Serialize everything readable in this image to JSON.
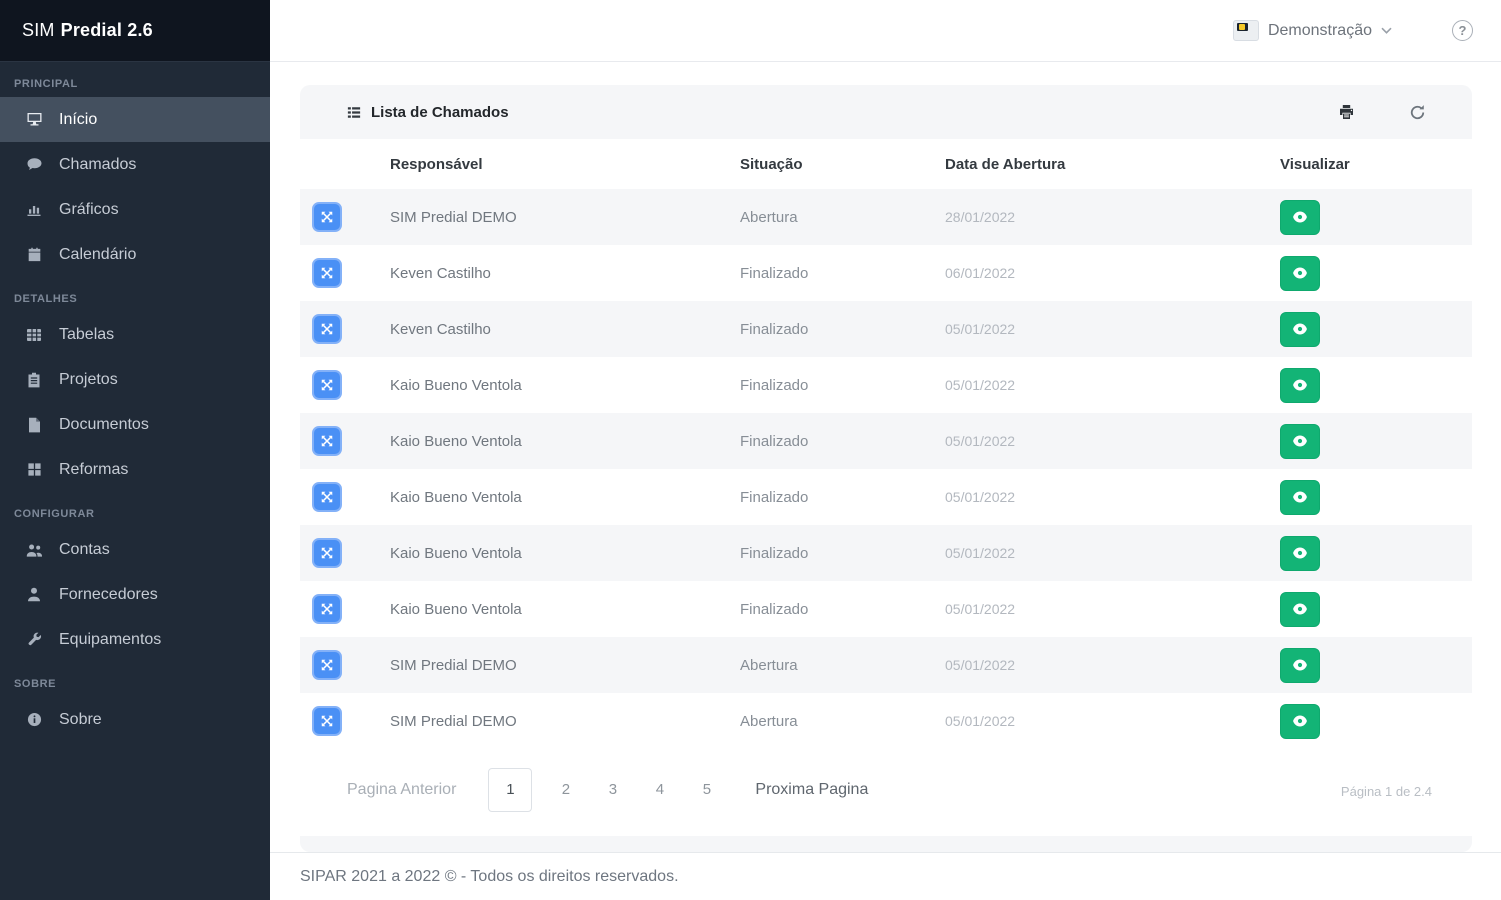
{
  "brand": {
    "name_light": "SIM",
    "name_bold": "Predial 2.6"
  },
  "sidebar": {
    "sections": [
      {
        "label": "PRINCIPAL",
        "items": [
          {
            "label": "Início",
            "icon": "desktop-icon",
            "active": true
          },
          {
            "label": "Chamados",
            "icon": "comment-icon",
            "active": false
          },
          {
            "label": "Gráficos",
            "icon": "chart-icon",
            "active": false
          },
          {
            "label": "Calendário",
            "icon": "calendar-icon",
            "active": false
          }
        ]
      },
      {
        "label": "DETALHES",
        "items": [
          {
            "label": "Tabelas",
            "icon": "table-icon",
            "active": false
          },
          {
            "label": "Projetos",
            "icon": "clipboard-icon",
            "active": false
          },
          {
            "label": "Documentos",
            "icon": "document-icon",
            "active": false
          },
          {
            "label": "Reformas",
            "icon": "grid-icon",
            "active": false
          }
        ]
      },
      {
        "label": "CONFIGURAR",
        "items": [
          {
            "label": "Contas",
            "icon": "users-icon",
            "active": false
          },
          {
            "label": "Fornecedores",
            "icon": "user-icon",
            "active": false
          },
          {
            "label": "Equipamentos",
            "icon": "wrench-icon",
            "active": false
          }
        ]
      },
      {
        "label": "SOBRE",
        "items": [
          {
            "label": "Sobre",
            "icon": "info-icon",
            "active": false
          }
        ]
      }
    ]
  },
  "topbar": {
    "account_label": "Demonstração",
    "help_label": "?"
  },
  "card": {
    "title": "Lista de Chamados",
    "title_icon": "list-icon",
    "actions": [
      "print-icon",
      "refresh-icon"
    ],
    "table": {
      "columns": [
        "Responsável",
        "Situação",
        "Data de Abertura",
        "Visualizar"
      ],
      "row_icon": "expand-arrows-icon",
      "view_icon": "eye-icon",
      "rows": [
        {
          "responsavel": "SIM Predial DEMO",
          "situacao": "Abertura",
          "data": "28/01/2022"
        },
        {
          "responsavel": "Keven Castilho",
          "situacao": "Finalizado",
          "data": "06/01/2022"
        },
        {
          "responsavel": "Keven Castilho",
          "situacao": "Finalizado",
          "data": "05/01/2022"
        },
        {
          "responsavel": "Kaio Bueno Ventola",
          "situacao": "Finalizado",
          "data": "05/01/2022"
        },
        {
          "responsavel": "Kaio Bueno Ventola",
          "situacao": "Finalizado",
          "data": "05/01/2022"
        },
        {
          "responsavel": "Kaio Bueno Ventola",
          "situacao": "Finalizado",
          "data": "05/01/2022"
        },
        {
          "responsavel": "Kaio Bueno Ventola",
          "situacao": "Finalizado",
          "data": "05/01/2022"
        },
        {
          "responsavel": "Kaio Bueno Ventola",
          "situacao": "Finalizado",
          "data": "05/01/2022"
        },
        {
          "responsavel": "SIM Predial DEMO",
          "situacao": "Abertura",
          "data": "05/01/2022"
        },
        {
          "responsavel": "SIM Predial DEMO",
          "situacao": "Abertura",
          "data": "05/01/2022"
        }
      ]
    },
    "pagination": {
      "prev_label": "Pagina Anterior",
      "pages": [
        "1",
        "2",
        "3",
        "4",
        "5"
      ],
      "current": "1",
      "next_label": "Proxima Pagina",
      "status": "Página 1 de 2.4"
    }
  },
  "footer": {
    "text": "SIPAR 2021 a 2022 © - Todos os direitos reservados."
  },
  "colors": {
    "sidebar_bg": "#202a37",
    "sidebar_brand_bg": "#0f151f",
    "sidebar_active_bg": "#44505f",
    "accent_blue": "#4a90f5",
    "accent_green": "#13b476",
    "stripe_gray": "#f5f6f8",
    "header_text": "#343a40"
  }
}
